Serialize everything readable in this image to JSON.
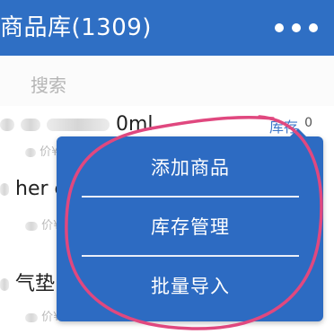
{
  "header": {
    "title": "商品库(1309)",
    "more_icon": "more-dots-icon"
  },
  "search": {
    "placeholder": "搜索"
  },
  "products": [
    {
      "name_visible": "0ml",
      "price_label": "价¥",
      "stock_label": "库存",
      "stock_value": "0"
    },
    {
      "name_visible": "her e",
      "price_label": "价¥",
      "stock_label": "",
      "stock_value": ""
    },
    {
      "name_visible": "气垫",
      "price_label": "价¥",
      "stock_label": "",
      "stock_value": ""
    }
  ],
  "popup_menu": {
    "items": [
      "添加商品",
      "库存管理",
      "批量导入"
    ]
  },
  "colors": {
    "header_bg": "#2f6fc4",
    "menu_bg": "#2d6bc2",
    "annotation": "#e0487f"
  }
}
